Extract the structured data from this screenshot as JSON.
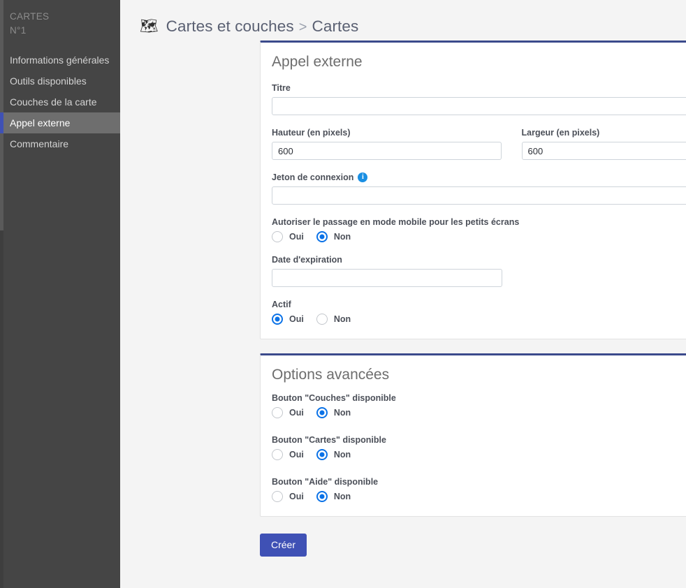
{
  "sidebar": {
    "brand_line1": "CARTES",
    "brand_line2": "N°1",
    "items": [
      {
        "label": "Informations générales",
        "active": false
      },
      {
        "label": "Outils disponibles",
        "active": false
      },
      {
        "label": "Couches de la carte",
        "active": false
      },
      {
        "label": "Appel externe",
        "active": true
      },
      {
        "label": "Commentaire",
        "active": false
      }
    ],
    "accent_color": "#3f51b5",
    "background_color": "#454545",
    "active_background_color": "#6e6e6e"
  },
  "header": {
    "icon": "map-icon",
    "icon_glyph": "🗺",
    "breadcrumb_root": "Cartes et couches",
    "breadcrumb_separator": ">",
    "breadcrumb_current": "Cartes"
  },
  "cards": {
    "appel_externe": {
      "title": "Appel externe",
      "collapse_icon": "chevron-down-icon",
      "accent_color": "#3b4a8c",
      "fields": {
        "titre": {
          "label": "Titre",
          "value": "",
          "placeholder": ""
        },
        "hauteur": {
          "label": "Hauteur (en pixels)",
          "value": "600",
          "placeholder": ""
        },
        "largeur": {
          "label": "Largeur (en pixels)",
          "value": "600",
          "placeholder": ""
        },
        "jeton": {
          "label": "Jeton de connexion",
          "value": "",
          "info_icon": "info-icon",
          "info_glyph": "i"
        },
        "mobile": {
          "label": "Autoriser le passage en mode mobile pour les petits écrans",
          "options": [
            "Oui",
            "Non"
          ],
          "selected": "Non"
        },
        "date_expiration": {
          "label": "Date d'expiration",
          "value": "",
          "placeholder": ""
        },
        "actif": {
          "label": "Actif",
          "options": [
            "Oui",
            "Non"
          ],
          "selected": "Oui"
        }
      }
    },
    "options_avancees": {
      "title": "Options avancées",
      "collapse_icon": "chevron-down-icon",
      "accent_color": "#3b4a8c",
      "toggles": [
        {
          "label": "Bouton \"Couches\" disponible",
          "options": [
            "Oui",
            "Non"
          ],
          "selected": "Non"
        },
        {
          "label": "Bouton \"Cartes\" disponible",
          "options": [
            "Oui",
            "Non"
          ],
          "selected": "Non"
        },
        {
          "label": "Bouton \"Aide\" disponible",
          "options": [
            "Oui",
            "Non"
          ],
          "selected": "Non"
        }
      ]
    }
  },
  "footer": {
    "submit_label": "Créer",
    "submit_color": "#3f51b5"
  }
}
